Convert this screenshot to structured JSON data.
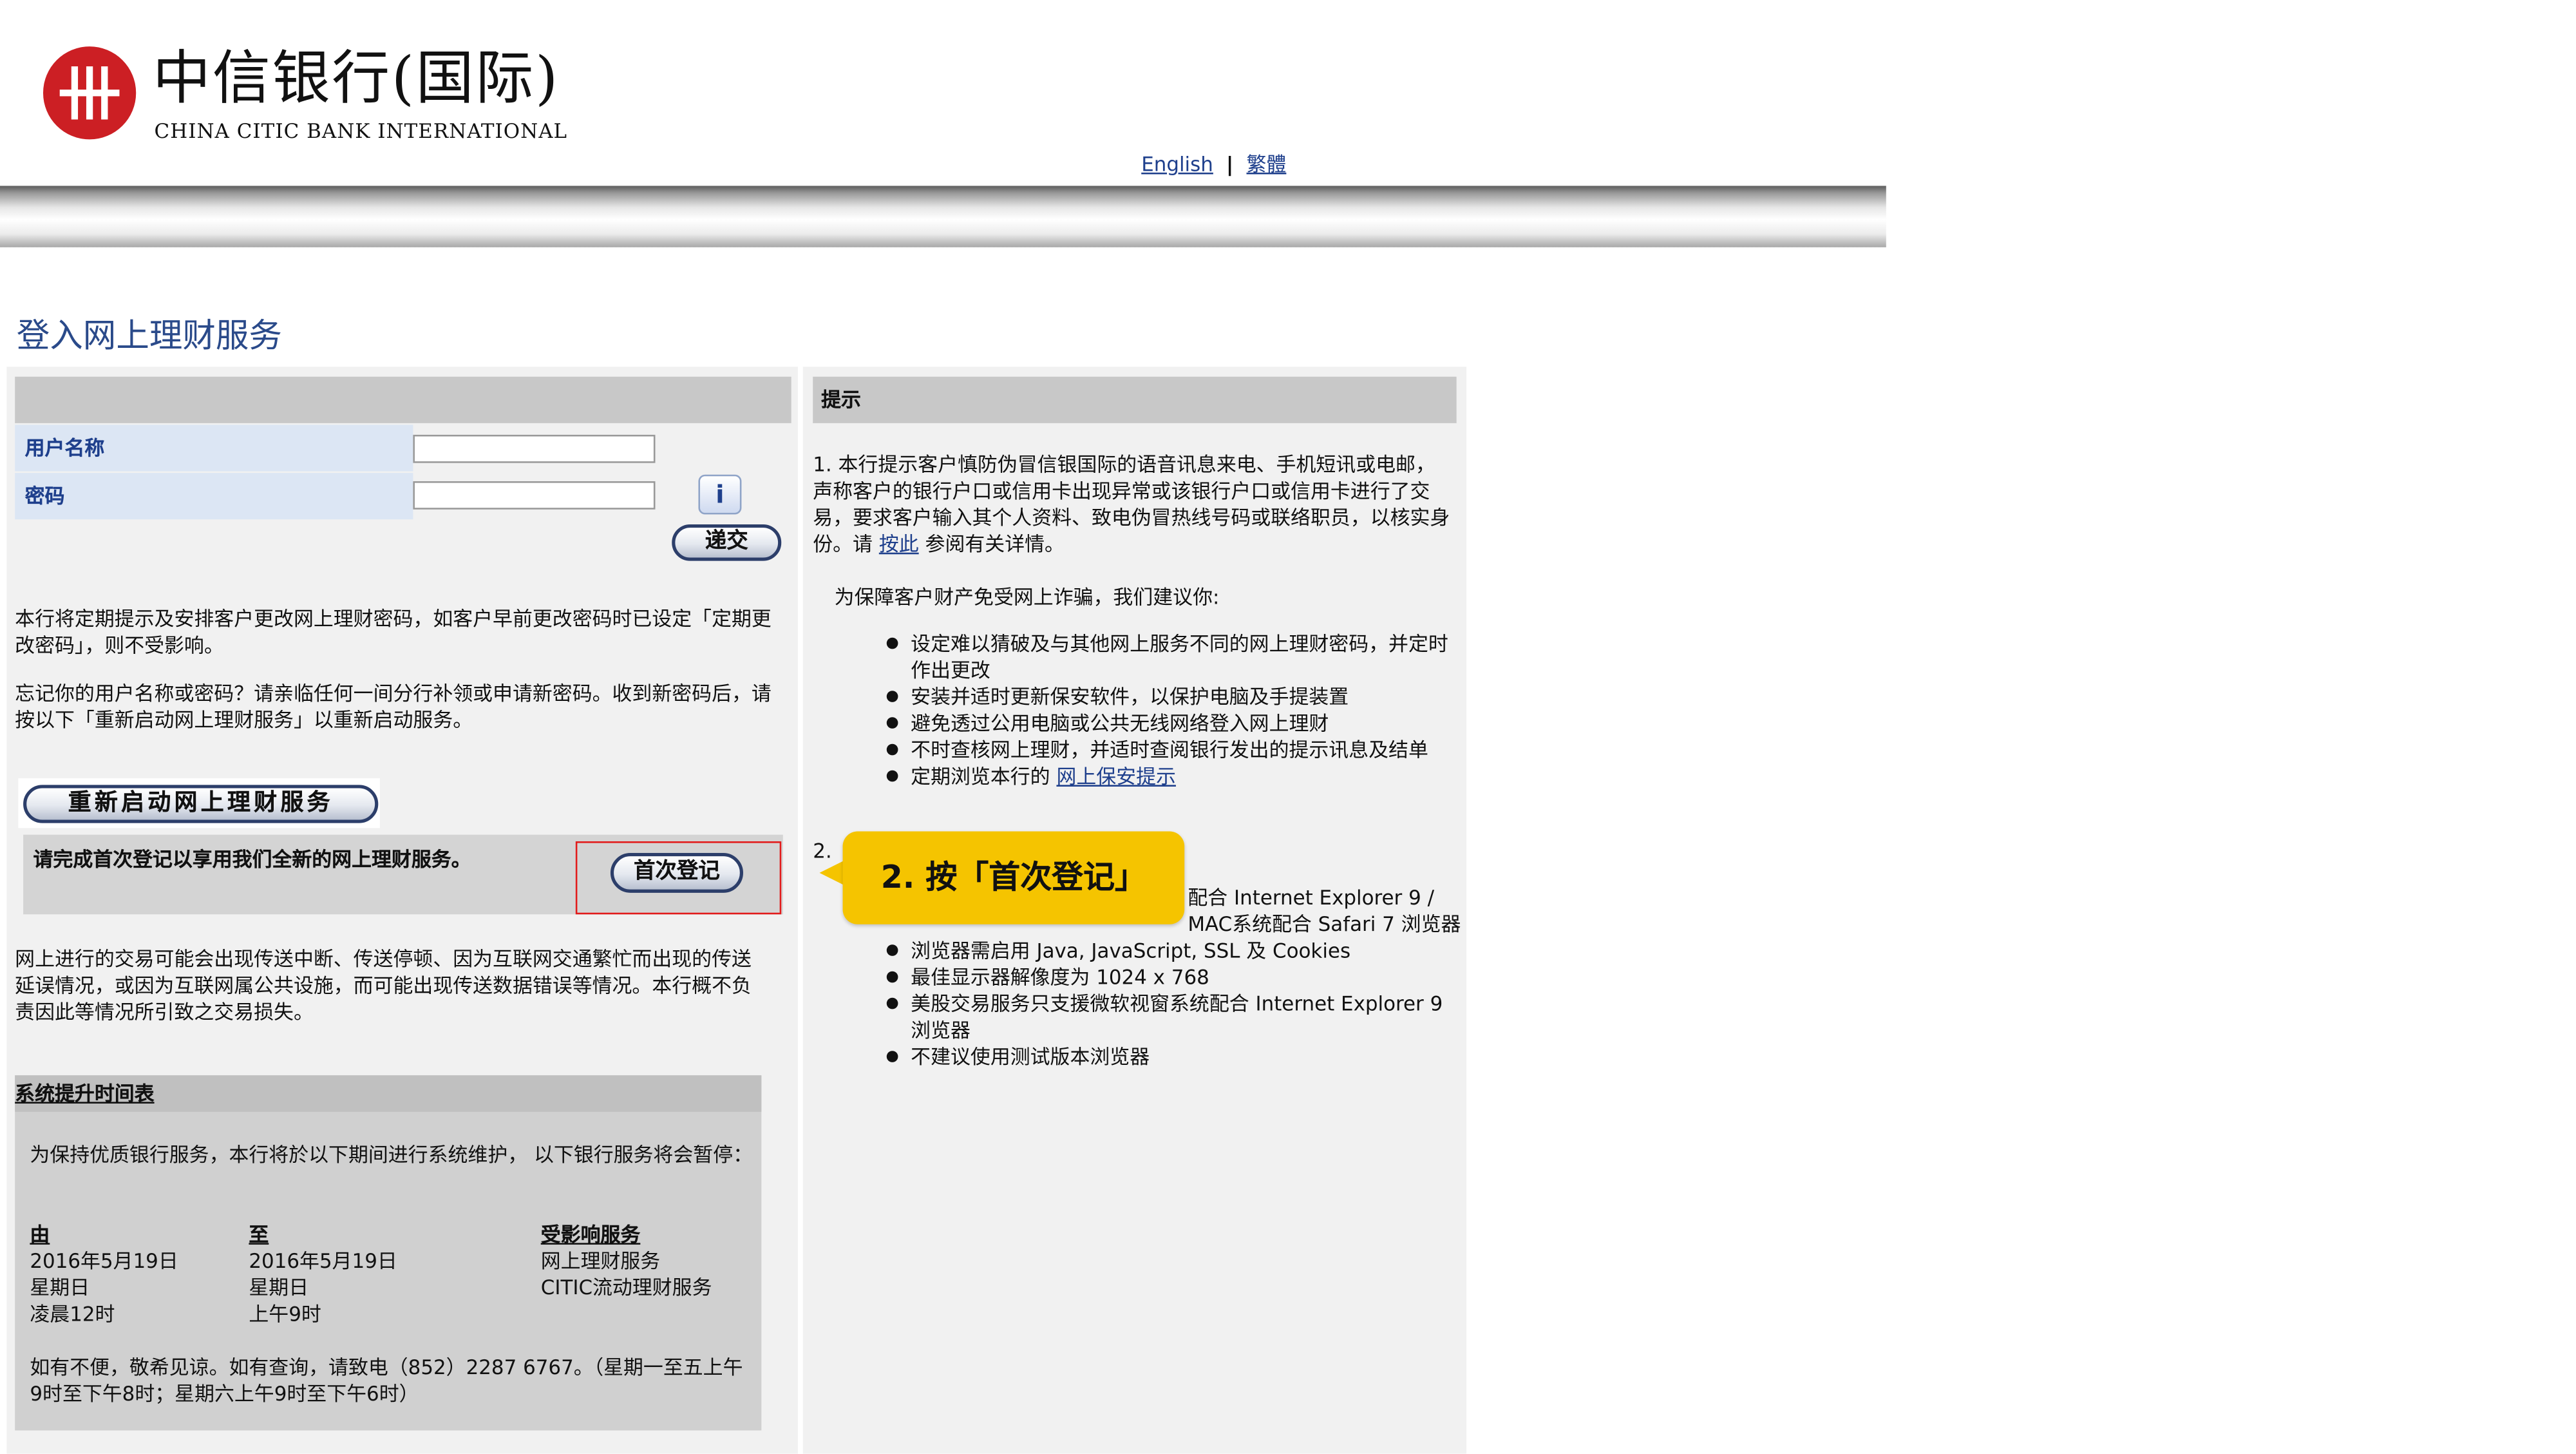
{
  "header": {
    "logo_cn": "中信银行(国际)",
    "logo_en": "CHINA CITIC BANK INTERNATIONAL",
    "lang_english": "English",
    "lang_separator": "|",
    "lang_traditional": "繁體"
  },
  "page_title": "登入网上理财服务",
  "login": {
    "username_label": "用户名称",
    "password_label": "密码",
    "username_value": "",
    "password_value": "",
    "info_icon_glyph": "i",
    "submit_label": "递交"
  },
  "notices": {
    "password_change": "本行将定期提示及安排客户更改网上理财密码，如客户早前更改密码时已设定「定期更改密码」，则不受影响。",
    "forgot": "忘记你的用户名称或密码？请亲临任何一间分行补领或申请新密码。收到新密码后，请按以下「重新启动网上理财服务」以重新启动服务。",
    "restart_button": "重新启动网上理财服务",
    "first_login_text": "请完成首次登记以享用我们全新的网上理财服务。",
    "first_login_button": "首次登记",
    "disclaimer": "网上进行的交易可能会出现传送中断、传送停顿、因为互联网交通繁忙而出现的传送延误情况，或因为互联网属公共设施，而可能出现传送数据错误等情况。本行概不负责因此等情况所引致之交易损失。"
  },
  "schedule": {
    "heading": "系统提升时间表",
    "intro": "为保持优质银行服务，本行将於以下期间进行系统维护， 以下银行服务将会暂停：",
    "col_from": "由",
    "col_to": "至",
    "col_affected": "受影响服务",
    "from_date": "2016年5月19日",
    "from_day": "星期日",
    "from_time": "凌晨12时",
    "to_date": "2016年5月19日",
    "to_day": "星期日",
    "to_time": "上午9时",
    "service_1": "网上理财服务",
    "service_2": "CITIC流动理财服务",
    "contact": "如有不便，敬希见谅。如有查询，请致电（852）2287 6767。（星期一至五上午9时至下午8时；星期六上午9时至下午6时）"
  },
  "tips": {
    "heading": "提示",
    "item1_before": "1. 本行提示客户慎防伪冒信银国际的语音讯息来电、手机短讯或电邮，声称客户的银行户口或信用卡出现异常或该银行户口或信用卡进行了交易，要求客户输入其个人资料、致电伪冒热线号码或联络职员，以核实身份。请",
    "item1_link": "按此",
    "item1_after": "参阅有关详情。",
    "protect_intro": "为保障客户财产免受网上诈骗，我们建议你:",
    "bullets": [
      "设定难以猜破及与其他网上服务不同的网上理财密码，并定时作出更改",
      "安装并适时更新保安软件，以保护电脑及手提装置",
      "避免透过公用电脑或公共无线网络登入网上理财",
      "不时查核网上理财，并适时查阅银行发出的提示讯息及结单"
    ],
    "bullet5_before": "定期浏览本行的",
    "bullet5_link": "网上保安提示",
    "item2_prefix": "2.",
    "browser_line1_tail": "配合 Internet Explorer 9 /",
    "browser_line2_tail": "MAC系统配合 Safari 7 浏览器",
    "browser_bullets": [
      "浏览器需启用 Java, JavaScript, SSL 及 Cookies",
      "最佳显示器解像度为 1024 x 768",
      "美股交易服务只支援微软视窗系统配合 Internet Explorer 9 浏览器",
      "不建议使用测试版本浏览器"
    ]
  },
  "callout": {
    "text": "2. 按「首次登记」",
    "color": "#F5C400"
  },
  "colors": {
    "brand_red": "#CC1F24",
    "link_blue": "#1E3F8C",
    "highlight_red": "#E21B1B"
  }
}
